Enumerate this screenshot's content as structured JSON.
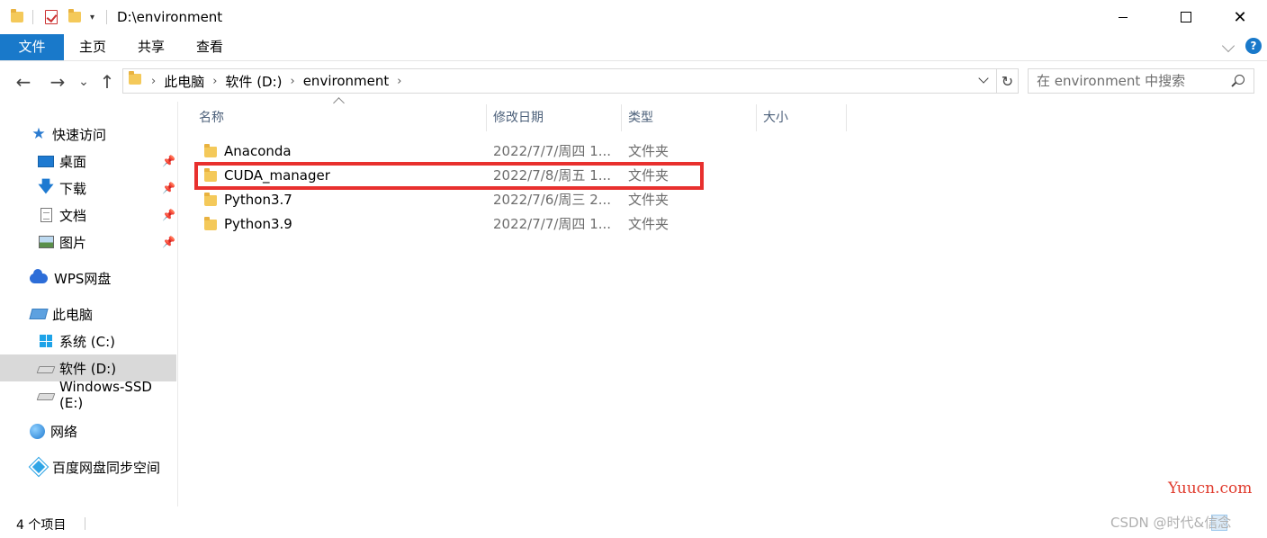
{
  "window": {
    "title": "D:\\environment",
    "minimize_icon": "minimize-icon",
    "maximize_icon": "maximize-icon",
    "close_glyph": "✕"
  },
  "ribbon": {
    "tabs": [
      "文件",
      "主页",
      "共享",
      "查看"
    ],
    "help_glyph": "?"
  },
  "nav": {
    "back_glyph": "←",
    "forward_glyph": "→",
    "recent_glyph": "⌄",
    "up_glyph": "↑",
    "refresh_glyph": "↻",
    "breadcrumb": [
      "此电脑",
      "软件 (D:)",
      "environment"
    ],
    "crumb_sep": "›",
    "search_placeholder": "在 environment 中搜索"
  },
  "sidebar": {
    "pin_glyph": "📌",
    "items": [
      {
        "label": "快速访问",
        "icon": "star-icon"
      },
      {
        "label": "桌面",
        "icon": "desktop-icon",
        "pinned": true
      },
      {
        "label": "下载",
        "icon": "download-icon",
        "pinned": true
      },
      {
        "label": "文档",
        "icon": "document-icon",
        "pinned": true
      },
      {
        "label": "图片",
        "icon": "picture-icon",
        "pinned": true
      },
      {
        "label": "WPS网盘",
        "icon": "cloud-icon"
      },
      {
        "label": "此电脑",
        "icon": "computer-icon"
      },
      {
        "label": "系统 (C:)",
        "icon": "windows-drive-icon"
      },
      {
        "label": "软件 (D:)",
        "icon": "drive-icon",
        "selected": true
      },
      {
        "label": "Windows-SSD (E:)",
        "icon": "drive-icon"
      },
      {
        "label": "网络",
        "icon": "network-icon"
      },
      {
        "label": "百度网盘同步空间",
        "icon": "baidu-netdisk-icon"
      }
    ]
  },
  "columns": [
    "名称",
    "修改日期",
    "类型",
    "大小"
  ],
  "files": [
    {
      "name": "Anaconda",
      "date": "2022/7/7/周四 1...",
      "type": "文件夹"
    },
    {
      "name": "CUDA_manager",
      "date": "2022/7/8/周五 1...",
      "type": "文件夹"
    },
    {
      "name": "Python3.7",
      "date": "2022/7/6/周三 2...",
      "type": "文件夹"
    },
    {
      "name": "Python3.9",
      "date": "2022/7/7/周四 1...",
      "type": "文件夹"
    }
  ],
  "status": {
    "item_count": "4 个项目"
  },
  "watermarks": {
    "site": "Yuucn.com",
    "csdn": "CSDN @时代&信念"
  },
  "colors": {
    "accent": "#1979ca",
    "highlight": "#e8302e",
    "folder": "#f4c95a"
  }
}
